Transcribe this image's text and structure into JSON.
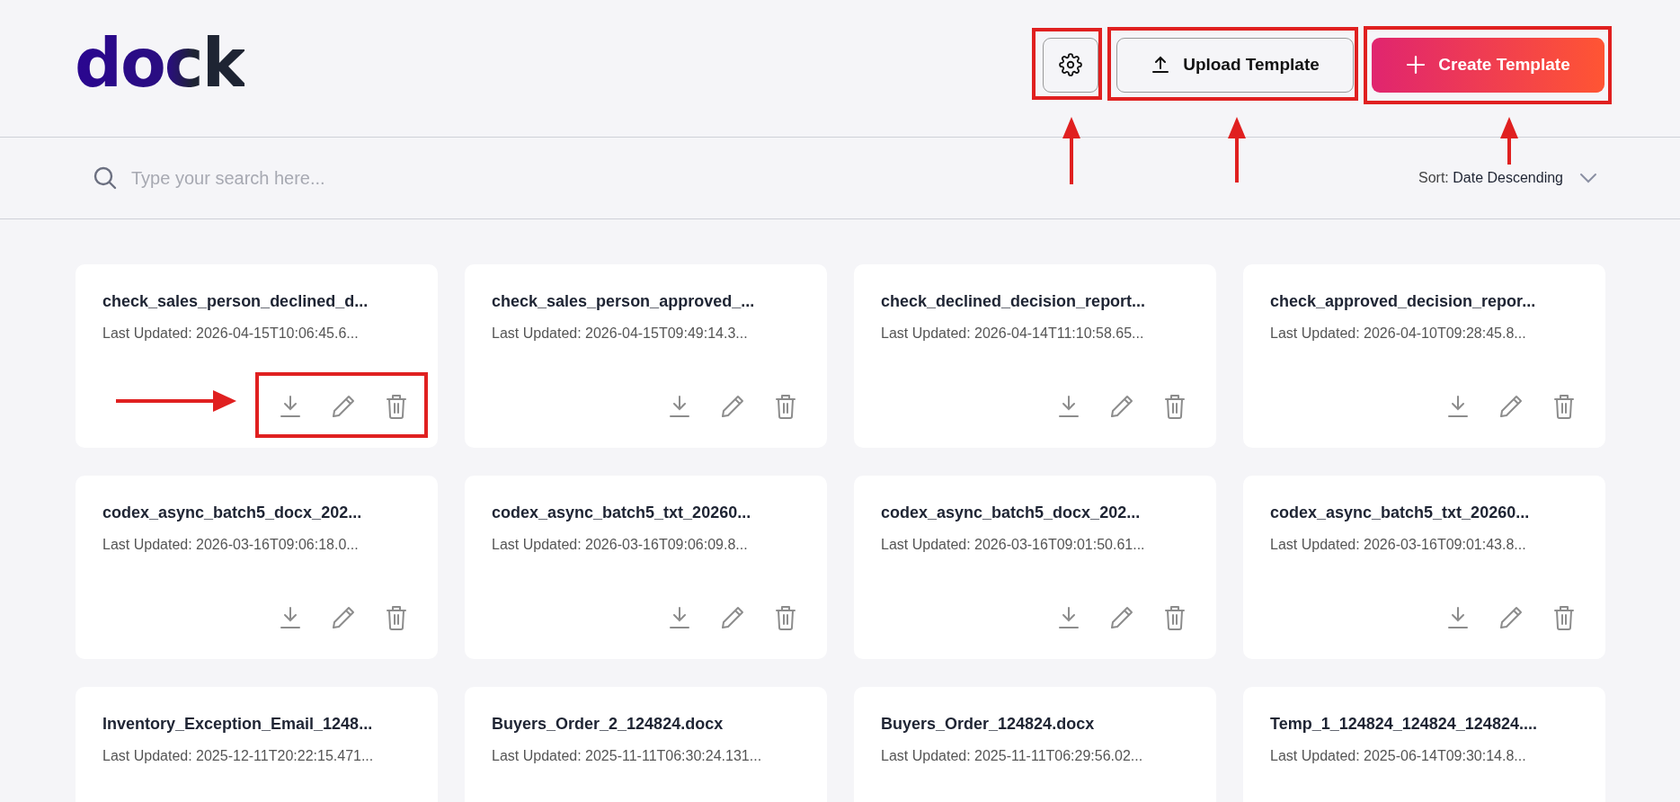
{
  "header": {
    "logo": "dock",
    "buttons": [
      {
        "kind": "settings"
      },
      {
        "kind": "upload",
        "label": "Upload Template"
      },
      {
        "kind": "create",
        "label": "Create Template"
      }
    ]
  },
  "search": {
    "placeholder": "Type your search here..."
  },
  "sort": {
    "label": "Sort:",
    "value": "Date Descending"
  },
  "templates": [
    {
      "title": "check_sales_person_declined_d...",
      "updated": "Last Updated: 2026-04-15T10:06:45.6..."
    },
    {
      "title": "check_sales_person_approved_...",
      "updated": "Last Updated: 2026-04-15T09:49:14.3..."
    },
    {
      "title": "check_declined_decision_report...",
      "updated": "Last Updated: 2026-04-14T11:10:58.65..."
    },
    {
      "title": "check_approved_decision_repor...",
      "updated": "Last Updated: 2026-04-10T09:28:45.8..."
    },
    {
      "title": "codex_async_batch5_docx_202...",
      "updated": "Last Updated: 2026-03-16T09:06:18.0..."
    },
    {
      "title": "codex_async_batch5_txt_20260...",
      "updated": "Last Updated: 2026-03-16T09:06:09.8..."
    },
    {
      "title": "codex_async_batch5_docx_202...",
      "updated": "Last Updated: 2026-03-16T09:01:50.61..."
    },
    {
      "title": "codex_async_batch5_txt_20260...",
      "updated": "Last Updated: 2026-03-16T09:01:43.8..."
    },
    {
      "title": "Inventory_Exception_Email_1248...",
      "updated": "Last Updated: 2025-12-11T20:22:15.471..."
    },
    {
      "title": "Buyers_Order_2_124824.docx",
      "updated": "Last Updated: 2025-11-11T06:30:24.131..."
    },
    {
      "title": "Buyers_Order_124824.docx",
      "updated": "Last Updated: 2025-11-11T06:29:56.02..."
    },
    {
      "title": "Temp_1_124824_124824_124824....",
      "updated": "Last Updated: 2025-06-14T09:30:14.8..."
    }
  ]
}
